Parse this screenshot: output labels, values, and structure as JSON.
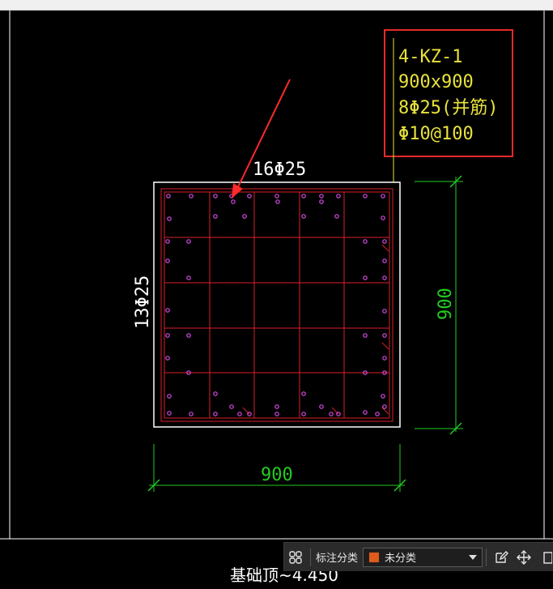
{
  "annotation": {
    "lines": [
      "4-KZ-1",
      "900x900",
      "8Φ25(并筋)",
      "Φ10@100"
    ],
    "label_color": "#e8e23a",
    "box_color": "#e52a2a"
  },
  "dimensions": {
    "top_rebar": "16Φ25",
    "side_rebar": "13Φ25",
    "bottom_width": "900",
    "right_height": "900",
    "dim_color": "#22cc22"
  },
  "footer_label": "基础顶~4.450",
  "colors": {
    "outline": "#ffffff",
    "grid": "#d9202a",
    "rebar": "#d84ae6",
    "arrow": "#ff2a2a"
  },
  "toolbar": {
    "label": "标注分类",
    "select_value": "未分类",
    "swatch_color": "#e05a1a"
  }
}
